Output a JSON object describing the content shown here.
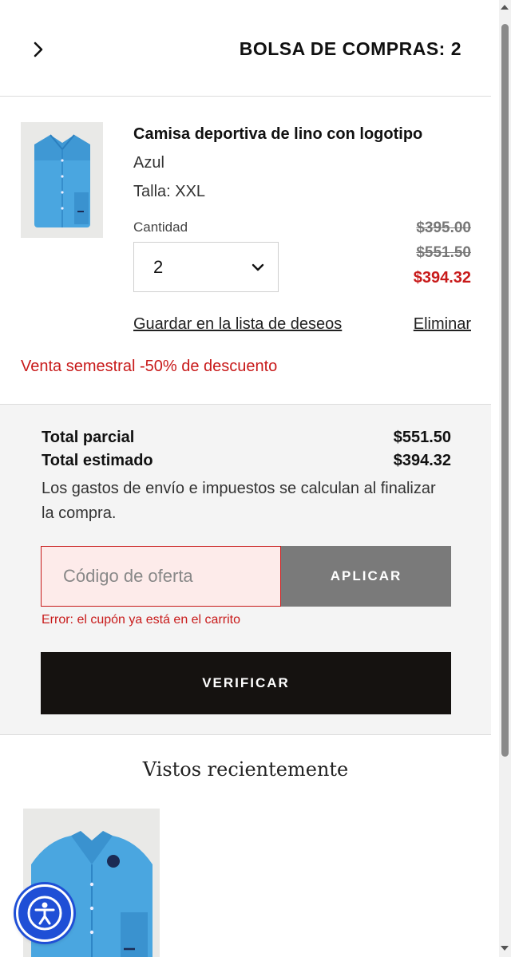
{
  "header": {
    "back_icon": "chevron-right-icon",
    "title": "BOLSA DE COMPRAS: 2"
  },
  "cart_item": {
    "name": "Camisa deportiva de lino con logotipo",
    "color": "Azul",
    "size": "Talla: XXL",
    "quantity_label": "Cantidad",
    "quantity_value": "2",
    "price_original_1": "$395.00",
    "price_original_2": "$551.50",
    "price_sale": "$394.32",
    "wishlist_link": "Guardar en la lista de deseos",
    "remove_link": "Eliminar",
    "promo_text": "Venta semestral -50% de descuento"
  },
  "summary": {
    "subtotal_label": "Total parcial",
    "subtotal_value": "$551.50",
    "estimated_label": "Total estimado",
    "estimated_value": "$394.32",
    "shipping_note": "Los gastos de envío e impuestos se calculan al finalizar la compra.",
    "coupon_placeholder": "Código de oferta",
    "apply_label": "APLICAR",
    "coupon_error": "Error: el cupón ya está en el carrito",
    "checkout_label": "VERIFICAR"
  },
  "recently_viewed": {
    "title": "Vistos recientemente"
  },
  "colors": {
    "accent_red": "#c81a1a",
    "checkout_bg": "#151210",
    "apply_bg": "#7a7a7a",
    "accessibility_blue": "#1f4fd6",
    "shirt_blue": "#4aa6e0"
  },
  "icons": {
    "quantity_dropdown": "chevron-down-icon",
    "accessibility": "accessibility-icon"
  }
}
